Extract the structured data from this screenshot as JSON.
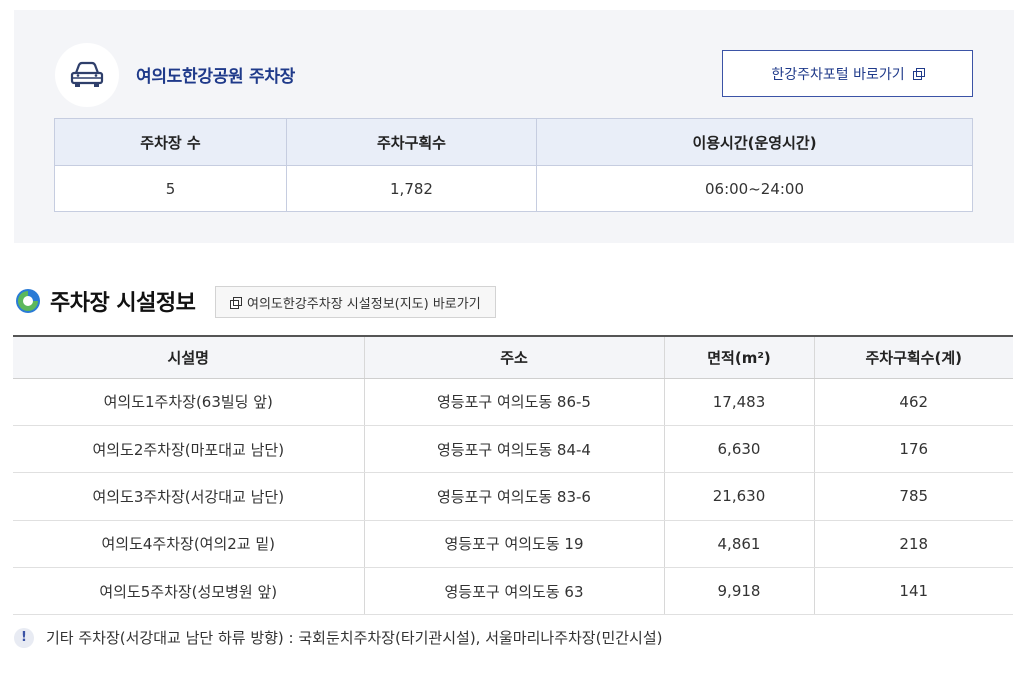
{
  "summary": {
    "title": "여의도한강공원 주차장",
    "portal_button": "한강주차포털 바로가기",
    "headers": [
      "주차장 수",
      "주차구획수",
      "이용시간(운영시간)"
    ],
    "values": [
      "5",
      "1,782",
      "06:00~24:00"
    ]
  },
  "facility": {
    "title": "주차장 시설정보",
    "map_link": "여의도한강주차장 시설정보(지도) 바로가기",
    "headers": [
      "시설명",
      "주소",
      "면적(m²)",
      "주차구획수(계)"
    ],
    "rows": [
      [
        "여의도1주차장(63빌딩 앞)",
        "영등포구 여의도동 86-5",
        "17,483",
        "462"
      ],
      [
        "여의도2주차장(마포대교 남단)",
        "영등포구 여의도동 84-4",
        "6,630",
        "176"
      ],
      [
        "여의도3주차장(서강대교 남단)",
        "영등포구 여의도동 83-6",
        "21,630",
        "785"
      ],
      [
        "여의도4주차장(여의2교 밑)",
        "영등포구 여의도동 19",
        "4,861",
        "218"
      ],
      [
        "여의도5주차장(성모병원 앞)",
        "영등포구 여의도동 63",
        "9,918",
        "141"
      ]
    ]
  },
  "note": {
    "icon": "!",
    "text": "기타 주차장(서강대교 남단 하류 방향) : 국회둔치주차장(타기관시설), 서울마리나주차장(민간시설)"
  },
  "colors": {
    "accent": "#1f3a8a",
    "leaf_blue": "#2a7bd6",
    "leaf_green": "#5cb85c"
  }
}
